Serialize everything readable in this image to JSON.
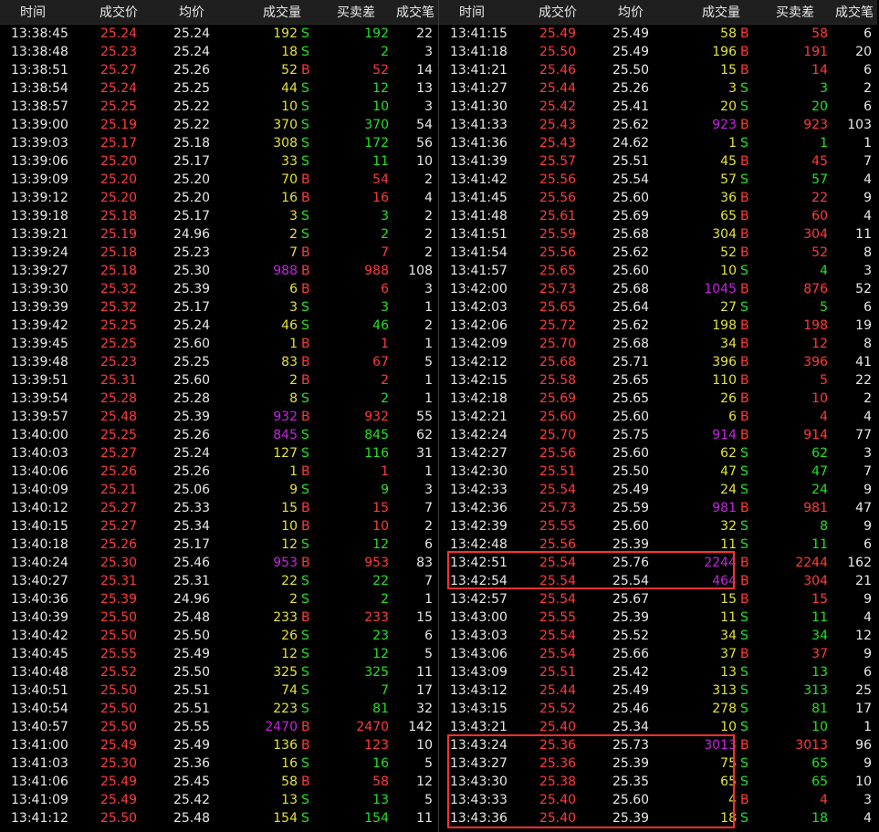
{
  "headers": {
    "time": "时间",
    "price": "成交价",
    "avg": "均价",
    "volume": "成交量",
    "diff": "买卖差",
    "count": "成交笔"
  },
  "colors": {
    "up": "#ff3b3b",
    "down": "#25e025",
    "volume": "#e3e33a",
    "big_volume": "#c424e0",
    "highlight": "#ff3030",
    "header_bg": "#1f1f1f"
  },
  "left_rows": [
    {
      "time": "13:38:45",
      "price": "25.24",
      "avg": "25.24",
      "vol": "192",
      "bs": "S",
      "diff": "192",
      "cnt": "22"
    },
    {
      "time": "13:38:48",
      "price": "25.23",
      "avg": "25.24",
      "vol": "18",
      "bs": "S",
      "diff": "2",
      "cnt": "3"
    },
    {
      "time": "13:38:51",
      "price": "25.27",
      "avg": "25.26",
      "vol": "52",
      "bs": "B",
      "diff": "52",
      "cnt": "14"
    },
    {
      "time": "13:38:54",
      "price": "25.24",
      "avg": "25.25",
      "vol": "44",
      "bs": "S",
      "diff": "12",
      "cnt": "13"
    },
    {
      "time": "13:38:57",
      "price": "25.25",
      "avg": "25.22",
      "vol": "10",
      "bs": "S",
      "diff": "10",
      "cnt": "3"
    },
    {
      "time": "13:39:00",
      "price": "25.19",
      "avg": "25.22",
      "vol": "370",
      "bs": "S",
      "diff": "370",
      "cnt": "54"
    },
    {
      "time": "13:39:03",
      "price": "25.17",
      "avg": "25.18",
      "vol": "308",
      "bs": "S",
      "diff": "172",
      "cnt": "56"
    },
    {
      "time": "13:39:06",
      "price": "25.20",
      "avg": "25.17",
      "vol": "33",
      "bs": "S",
      "diff": "11",
      "cnt": "10"
    },
    {
      "time": "13:39:09",
      "price": "25.20",
      "avg": "25.20",
      "vol": "70",
      "bs": "B",
      "diff": "54",
      "cnt": "2"
    },
    {
      "time": "13:39:12",
      "price": "25.20",
      "avg": "25.20",
      "vol": "16",
      "bs": "B",
      "diff": "16",
      "cnt": "4"
    },
    {
      "time": "13:39:18",
      "price": "25.18",
      "avg": "25.17",
      "vol": "3",
      "bs": "S",
      "diff": "3",
      "cnt": "2"
    },
    {
      "time": "13:39:21",
      "price": "25.19",
      "avg": "24.96",
      "vol": "2",
      "bs": "S",
      "diff": "2",
      "cnt": "2"
    },
    {
      "time": "13:39:24",
      "price": "25.18",
      "avg": "25.23",
      "vol": "7",
      "bs": "B",
      "diff": "7",
      "cnt": "2"
    },
    {
      "time": "13:39:27",
      "price": "25.18",
      "avg": "25.30",
      "vol": "988",
      "bs": "B",
      "diff": "988",
      "cnt": "108"
    },
    {
      "time": "13:39:30",
      "price": "25.32",
      "avg": "25.39",
      "vol": "6",
      "bs": "B",
      "diff": "6",
      "cnt": "3"
    },
    {
      "time": "13:39:39",
      "price": "25.32",
      "avg": "25.17",
      "vol": "3",
      "bs": "S",
      "diff": "3",
      "cnt": "1"
    },
    {
      "time": "13:39:42",
      "price": "25.25",
      "avg": "25.24",
      "vol": "46",
      "bs": "S",
      "diff": "46",
      "cnt": "2"
    },
    {
      "time": "13:39:45",
      "price": "25.25",
      "avg": "25.60",
      "vol": "1",
      "bs": "B",
      "diff": "1",
      "cnt": "1"
    },
    {
      "time": "13:39:48",
      "price": "25.23",
      "avg": "25.25",
      "vol": "83",
      "bs": "B",
      "diff": "67",
      "cnt": "5"
    },
    {
      "time": "13:39:51",
      "price": "25.31",
      "avg": "25.60",
      "vol": "2",
      "bs": "B",
      "diff": "2",
      "cnt": "1"
    },
    {
      "time": "13:39:54",
      "price": "25.28",
      "avg": "25.28",
      "vol": "8",
      "bs": "S",
      "diff": "2",
      "cnt": "1"
    },
    {
      "time": "13:39:57",
      "price": "25.48",
      "avg": "25.39",
      "vol": "932",
      "bs": "B",
      "diff": "932",
      "cnt": "55"
    },
    {
      "time": "13:40:00",
      "price": "25.25",
      "avg": "25.26",
      "vol": "845",
      "bs": "S",
      "diff": "845",
      "cnt": "62"
    },
    {
      "time": "13:40:03",
      "price": "25.27",
      "avg": "25.24",
      "vol": "127",
      "bs": "S",
      "diff": "116",
      "cnt": "31"
    },
    {
      "time": "13:40:06",
      "price": "25.26",
      "avg": "25.26",
      "vol": "1",
      "bs": "B",
      "diff": "1",
      "cnt": "1"
    },
    {
      "time": "13:40:09",
      "price": "25.21",
      "avg": "25.06",
      "vol": "9",
      "bs": "S",
      "diff": "9",
      "cnt": "3"
    },
    {
      "time": "13:40:12",
      "price": "25.27",
      "avg": "25.33",
      "vol": "15",
      "bs": "B",
      "diff": "15",
      "cnt": "7"
    },
    {
      "time": "13:40:15",
      "price": "25.27",
      "avg": "25.34",
      "vol": "10",
      "bs": "B",
      "diff": "10",
      "cnt": "2"
    },
    {
      "time": "13:40:18",
      "price": "25.26",
      "avg": "25.17",
      "vol": "12",
      "bs": "S",
      "diff": "12",
      "cnt": "6"
    },
    {
      "time": "13:40:24",
      "price": "25.30",
      "avg": "25.46",
      "vol": "953",
      "bs": "B",
      "diff": "953",
      "cnt": "83"
    },
    {
      "time": "13:40:27",
      "price": "25.31",
      "avg": "25.31",
      "vol": "22",
      "bs": "S",
      "diff": "22",
      "cnt": "7"
    },
    {
      "time": "13:40:36",
      "price": "25.39",
      "avg": "24.96",
      "vol": "2",
      "bs": "S",
      "diff": "2",
      "cnt": "1"
    },
    {
      "time": "13:40:39",
      "price": "25.50",
      "avg": "25.48",
      "vol": "233",
      "bs": "B",
      "diff": "233",
      "cnt": "15"
    },
    {
      "time": "13:40:42",
      "price": "25.50",
      "avg": "25.50",
      "vol": "26",
      "bs": "S",
      "diff": "23",
      "cnt": "6"
    },
    {
      "time": "13:40:45",
      "price": "25.55",
      "avg": "25.49",
      "vol": "12",
      "bs": "S",
      "diff": "12",
      "cnt": "5"
    },
    {
      "time": "13:40:48",
      "price": "25.52",
      "avg": "25.50",
      "vol": "325",
      "bs": "S",
      "diff": "325",
      "cnt": "11"
    },
    {
      "time": "13:40:51",
      "price": "25.50",
      "avg": "25.51",
      "vol": "74",
      "bs": "S",
      "diff": "7",
      "cnt": "17"
    },
    {
      "time": "13:40:54",
      "price": "25.50",
      "avg": "25.51",
      "vol": "223",
      "bs": "S",
      "diff": "81",
      "cnt": "32"
    },
    {
      "time": "13:40:57",
      "price": "25.50",
      "avg": "25.55",
      "vol": "2470",
      "bs": "B",
      "diff": "2470",
      "cnt": "142"
    },
    {
      "time": "13:41:00",
      "price": "25.49",
      "avg": "25.49",
      "vol": "136",
      "bs": "B",
      "diff": "123",
      "cnt": "10"
    },
    {
      "time": "13:41:03",
      "price": "25.30",
      "avg": "25.36",
      "vol": "16",
      "bs": "S",
      "diff": "16",
      "cnt": "5"
    },
    {
      "time": "13:41:06",
      "price": "25.49",
      "avg": "25.45",
      "vol": "58",
      "bs": "B",
      "diff": "58",
      "cnt": "12"
    },
    {
      "time": "13:41:09",
      "price": "25.49",
      "avg": "25.42",
      "vol": "13",
      "bs": "S",
      "diff": "13",
      "cnt": "5"
    },
    {
      "time": "13:41:12",
      "price": "25.50",
      "avg": "25.48",
      "vol": "154",
      "bs": "S",
      "diff": "154",
      "cnt": "11"
    }
  ],
  "right_rows": [
    {
      "time": "13:41:15",
      "price": "25.49",
      "avg": "25.49",
      "vol": "58",
      "bs": "B",
      "diff": "58",
      "cnt": "6"
    },
    {
      "time": "13:41:18",
      "price": "25.50",
      "avg": "25.49",
      "vol": "196",
      "bs": "B",
      "diff": "191",
      "cnt": "20"
    },
    {
      "time": "13:41:21",
      "price": "25.46",
      "avg": "25.50",
      "vol": "15",
      "bs": "B",
      "diff": "14",
      "cnt": "6"
    },
    {
      "time": "13:41:27",
      "price": "25.44",
      "avg": "25.26",
      "vol": "3",
      "bs": "S",
      "diff": "3",
      "cnt": "2"
    },
    {
      "time": "13:41:30",
      "price": "25.42",
      "avg": "25.41",
      "vol": "20",
      "bs": "S",
      "diff": "20",
      "cnt": "6"
    },
    {
      "time": "13:41:33",
      "price": "25.43",
      "avg": "25.62",
      "vol": "923",
      "bs": "B",
      "diff": "923",
      "cnt": "103"
    },
    {
      "time": "13:41:36",
      "price": "25.43",
      "avg": "24.62",
      "vol": "1",
      "bs": "S",
      "diff": "1",
      "cnt": "1"
    },
    {
      "time": "13:41:39",
      "price": "25.57",
      "avg": "25.51",
      "vol": "45",
      "bs": "B",
      "diff": "45",
      "cnt": "7"
    },
    {
      "time": "13:41:42",
      "price": "25.56",
      "avg": "25.54",
      "vol": "57",
      "bs": "S",
      "diff": "57",
      "cnt": "4"
    },
    {
      "time": "13:41:45",
      "price": "25.56",
      "avg": "25.60",
      "vol": "36",
      "bs": "B",
      "diff": "22",
      "cnt": "9"
    },
    {
      "time": "13:41:48",
      "price": "25.61",
      "avg": "25.69",
      "vol": "65",
      "bs": "B",
      "diff": "60",
      "cnt": "4"
    },
    {
      "time": "13:41:51",
      "price": "25.59",
      "avg": "25.68",
      "vol": "304",
      "bs": "B",
      "diff": "304",
      "cnt": "11"
    },
    {
      "time": "13:41:54",
      "price": "25.56",
      "avg": "25.62",
      "vol": "52",
      "bs": "B",
      "diff": "52",
      "cnt": "8"
    },
    {
      "time": "13:41:57",
      "price": "25.65",
      "avg": "25.60",
      "vol": "10",
      "bs": "S",
      "diff": "4",
      "cnt": "3"
    },
    {
      "time": "13:42:00",
      "price": "25.73",
      "avg": "25.68",
      "vol": "1045",
      "bs": "B",
      "diff": "876",
      "cnt": "52"
    },
    {
      "time": "13:42:03",
      "price": "25.65",
      "avg": "25.64",
      "vol": "27",
      "bs": "S",
      "diff": "5",
      "cnt": "6"
    },
    {
      "time": "13:42:06",
      "price": "25.72",
      "avg": "25.62",
      "vol": "198",
      "bs": "B",
      "diff": "198",
      "cnt": "19"
    },
    {
      "time": "13:42:09",
      "price": "25.70",
      "avg": "25.68",
      "vol": "34",
      "bs": "B",
      "diff": "12",
      "cnt": "8"
    },
    {
      "time": "13:42:12",
      "price": "25.68",
      "avg": "25.71",
      "vol": "396",
      "bs": "B",
      "diff": "396",
      "cnt": "41"
    },
    {
      "time": "13:42:15",
      "price": "25.58",
      "avg": "25.65",
      "vol": "110",
      "bs": "B",
      "diff": "5",
      "cnt": "22"
    },
    {
      "time": "13:42:18",
      "price": "25.69",
      "avg": "25.65",
      "vol": "26",
      "bs": "B",
      "diff": "10",
      "cnt": "2"
    },
    {
      "time": "13:42:21",
      "price": "25.60",
      "avg": "25.60",
      "vol": "6",
      "bs": "B",
      "diff": "4",
      "cnt": "4"
    },
    {
      "time": "13:42:24",
      "price": "25.70",
      "avg": "25.75",
      "vol": "914",
      "bs": "B",
      "diff": "914",
      "cnt": "77"
    },
    {
      "time": "13:42:27",
      "price": "25.56",
      "avg": "25.60",
      "vol": "62",
      "bs": "S",
      "diff": "62",
      "cnt": "3"
    },
    {
      "time": "13:42:30",
      "price": "25.51",
      "avg": "25.50",
      "vol": "47",
      "bs": "S",
      "diff": "47",
      "cnt": "7"
    },
    {
      "time": "13:42:33",
      "price": "25.54",
      "avg": "25.49",
      "vol": "24",
      "bs": "S",
      "diff": "24",
      "cnt": "9"
    },
    {
      "time": "13:42:36",
      "price": "25.73",
      "avg": "25.59",
      "vol": "981",
      "bs": "B",
      "diff": "981",
      "cnt": "47"
    },
    {
      "time": "13:42:39",
      "price": "25.55",
      "avg": "25.60",
      "vol": "32",
      "bs": "S",
      "diff": "8",
      "cnt": "9"
    },
    {
      "time": "13:42:48",
      "price": "25.56",
      "avg": "25.39",
      "vol": "11",
      "bs": "S",
      "diff": "11",
      "cnt": "6"
    },
    {
      "time": "13:42:51",
      "price": "25.54",
      "avg": "25.76",
      "vol": "2244",
      "bs": "B",
      "diff": "2244",
      "cnt": "162"
    },
    {
      "time": "13:42:54",
      "price": "25.54",
      "avg": "25.54",
      "vol": "464",
      "bs": "B",
      "diff": "304",
      "cnt": "21"
    },
    {
      "time": "13:42:57",
      "price": "25.54",
      "avg": "25.67",
      "vol": "15",
      "bs": "B",
      "diff": "15",
      "cnt": "9"
    },
    {
      "time": "13:43:00",
      "price": "25.55",
      "avg": "25.39",
      "vol": "11",
      "bs": "S",
      "diff": "11",
      "cnt": "4"
    },
    {
      "time": "13:43:03",
      "price": "25.54",
      "avg": "25.52",
      "vol": "34",
      "bs": "S",
      "diff": "34",
      "cnt": "12"
    },
    {
      "time": "13:43:06",
      "price": "25.54",
      "avg": "25.66",
      "vol": "37",
      "bs": "B",
      "diff": "37",
      "cnt": "9"
    },
    {
      "time": "13:43:09",
      "price": "25.51",
      "avg": "25.42",
      "vol": "13",
      "bs": "S",
      "diff": "13",
      "cnt": "6"
    },
    {
      "time": "13:43:12",
      "price": "25.44",
      "avg": "25.49",
      "vol": "313",
      "bs": "S",
      "diff": "313",
      "cnt": "25"
    },
    {
      "time": "13:43:15",
      "price": "25.52",
      "avg": "25.46",
      "vol": "278",
      "bs": "S",
      "diff": "81",
      "cnt": "17"
    },
    {
      "time": "13:43:21",
      "price": "25.40",
      "avg": "25.34",
      "vol": "10",
      "bs": "S",
      "diff": "10",
      "cnt": "1"
    },
    {
      "time": "13:43:24",
      "price": "25.36",
      "avg": "25.73",
      "vol": "3013",
      "bs": "B",
      "diff": "3013",
      "cnt": "96"
    },
    {
      "time": "13:43:27",
      "price": "25.36",
      "avg": "25.39",
      "vol": "75",
      "bs": "S",
      "diff": "65",
      "cnt": "9"
    },
    {
      "time": "13:43:30",
      "price": "25.38",
      "avg": "25.35",
      "vol": "65",
      "bs": "S",
      "diff": "65",
      "cnt": "10"
    },
    {
      "time": "13:43:33",
      "price": "25.40",
      "avg": "25.60",
      "vol": "4",
      "bs": "B",
      "diff": "4",
      "cnt": "3"
    },
    {
      "time": "13:43:36",
      "price": "25.40",
      "avg": "25.39",
      "vol": "18",
      "bs": "S",
      "diff": "18",
      "cnt": "4"
    }
  ]
}
